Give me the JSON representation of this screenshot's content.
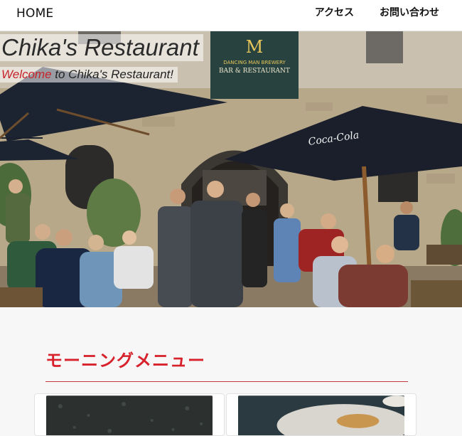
{
  "nav": {
    "home": "HOME",
    "access": "アクセス",
    "contact": "お問い合わせ"
  },
  "hero": {
    "title": "Chika's Restaurant",
    "subtitle_accent": "Welcome",
    "subtitle_rest": " to Chika's Restaurant!",
    "sign_top": "DANCING MAN BREWERY",
    "sign_bottom": "BAR & RESTAURANT",
    "umbrella_brand": "Coca-Cola"
  },
  "section": {
    "title": "モーニングメニュー"
  },
  "colors": {
    "accent": "#c7232b",
    "section_red": "#d7212b"
  }
}
